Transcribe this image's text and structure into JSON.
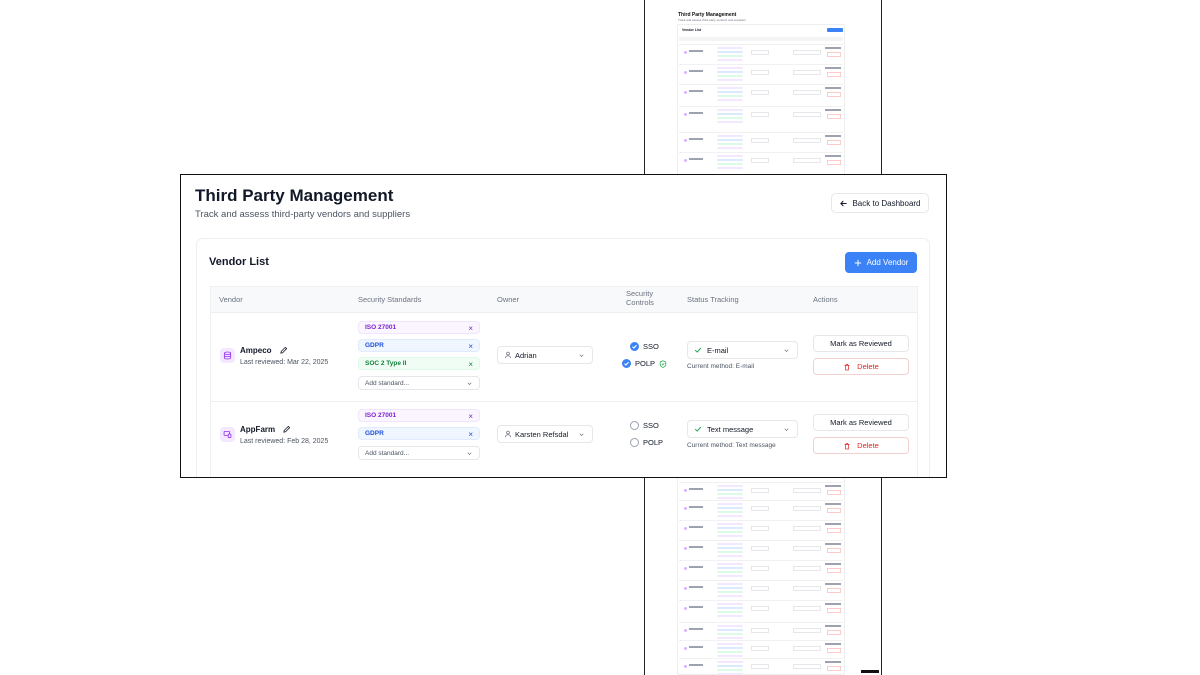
{
  "page": {
    "title": "Third Party Management",
    "subtitle": "Track and assess third-party vendors and suppliers",
    "back_button": "Back to Dashboard"
  },
  "vendor_list": {
    "title": "Vendor List",
    "add_button": "Add Vendor",
    "columns": {
      "vendor": "Vendor",
      "security_standards": "Security Standards",
      "owner": "Owner",
      "security_controls_line1": "Security",
      "security_controls_line2": "Controls",
      "status_tracking": "Status Tracking",
      "actions": "Actions"
    },
    "rows": [
      {
        "name": "Ampeco",
        "last_reviewed": "Last reviewed: Mar 22, 2025",
        "standards": [
          "ISO 27001",
          "GDPR",
          "SOC 2 Type II"
        ],
        "add_standard": "Add standard...",
        "owner": "Adrian",
        "controls": [
          {
            "label": "SSO",
            "checked": true
          },
          {
            "label": "POLP",
            "checked": true
          }
        ],
        "status": "E-mail",
        "current_method": "Current method: E-mail",
        "mark_reviewed": "Mark as Reviewed",
        "delete": "Delete"
      },
      {
        "name": "AppFarm",
        "last_reviewed": "Last reviewed: Feb 28, 2025",
        "standards": [
          "ISO 27001",
          "GDPR"
        ],
        "add_standard": "Add standard...",
        "owner": "Karsten Refsdal",
        "controls": [
          {
            "label": "SSO",
            "checked": false
          },
          {
            "label": "POLP",
            "checked": false
          }
        ],
        "status": "Text message",
        "current_method": "Current method: Text message",
        "mark_reviewed": "Mark as Reviewed",
        "delete": "Delete"
      }
    ]
  },
  "colors": {
    "accent": "#3b82f6",
    "danger": "#dc2626",
    "purple_tag": "#7e22ce",
    "blue_tag": "#1d4ed8",
    "green_tag": "#15803d"
  }
}
